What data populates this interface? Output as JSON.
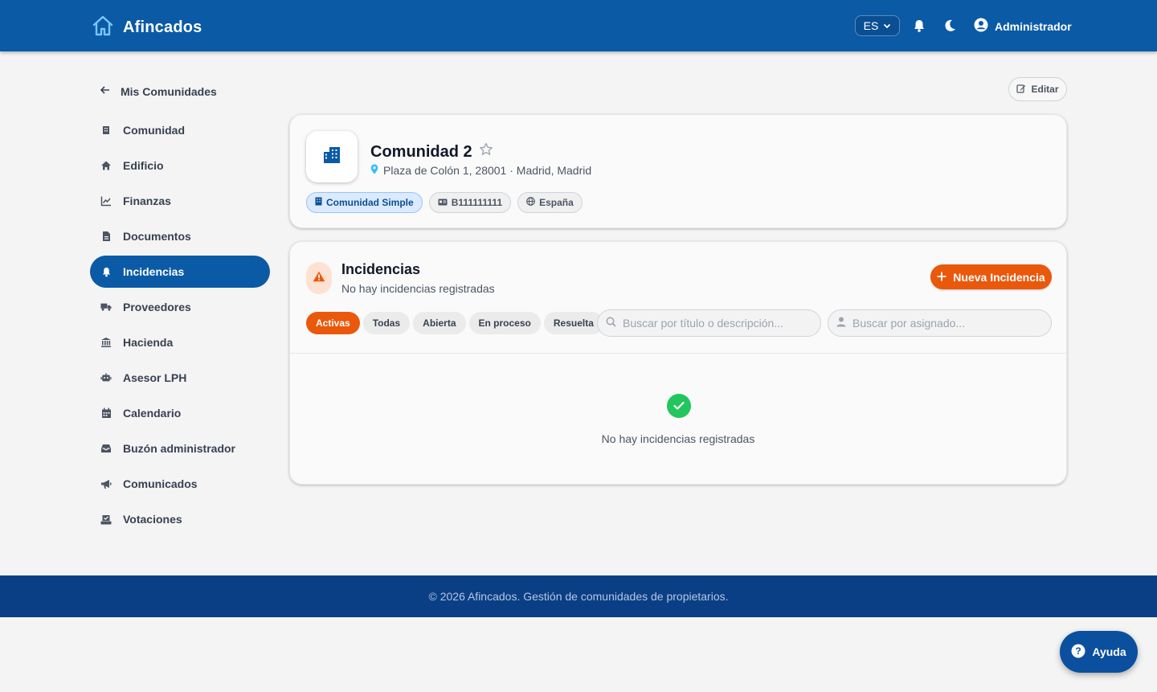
{
  "header": {
    "brand": "Afincados",
    "language": "ES",
    "user": "Administrador"
  },
  "sidebar": {
    "back_label": "Mis Comunidades",
    "items": [
      {
        "label": "Comunidad",
        "icon": "building-icon"
      },
      {
        "label": "Edificio",
        "icon": "home-icon"
      },
      {
        "label": "Finanzas",
        "icon": "chart-line-icon"
      },
      {
        "label": "Documentos",
        "icon": "document-icon"
      },
      {
        "label": "Incidencias",
        "icon": "bell-icon",
        "active": true
      },
      {
        "label": "Proveedores",
        "icon": "truck-icon"
      },
      {
        "label": "Hacienda",
        "icon": "bank-icon"
      },
      {
        "label": "Asesor LPH",
        "icon": "robot-icon"
      },
      {
        "label": "Calendario",
        "icon": "calendar-icon"
      },
      {
        "label": "Buzón administrador",
        "icon": "inbox-icon"
      },
      {
        "label": "Comunicados",
        "icon": "megaphone-icon"
      },
      {
        "label": "Votaciones",
        "icon": "ballot-icon"
      }
    ]
  },
  "actions": {
    "edit_label": "Editar"
  },
  "community": {
    "name": "Comunidad 2",
    "address": "Plaza de Colón 1, 28001 · Madrid, Madrid",
    "chips": [
      "Comunidad Simple",
      "B111111111",
      "España"
    ]
  },
  "incidents": {
    "title": "Incidencias",
    "subtitle": "No hay incidencias registradas",
    "new_button": "Nueva Incidencia",
    "filters": [
      "Activas",
      "Todas",
      "Abierta",
      "En proceso",
      "Resuelta"
    ],
    "active_filter": "Activas",
    "search_title_placeholder": "Buscar por título o descripción...",
    "search_assignee_placeholder": "Buscar por asignado...",
    "empty_text": "No hay incidencias registradas"
  },
  "footer": {
    "text": "© 2026 Afincados. Gestión de comunidades de propietarios."
  },
  "help": {
    "label": "Ayuda"
  },
  "colors": {
    "primary": "#0b5aa6",
    "accent": "#ea580c",
    "success": "#22c55e",
    "footer": "#0a3f86"
  }
}
